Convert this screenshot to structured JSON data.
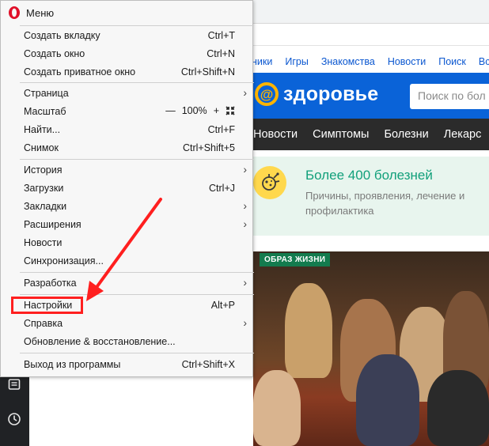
{
  "menu": {
    "title": "Меню",
    "groups": [
      [
        {
          "label": "Создать вкладку",
          "shortcut": "Ctrl+T"
        },
        {
          "label": "Создать окно",
          "shortcut": "Ctrl+N"
        },
        {
          "label": "Создать приватное окно",
          "shortcut": "Ctrl+Shift+N"
        }
      ],
      [
        {
          "label": "Страница",
          "submenu": true
        },
        {
          "label": "Масштаб",
          "zoom": {
            "minus": "—",
            "value": "100%",
            "plus": "+"
          }
        },
        {
          "label": "Найти...",
          "shortcut": "Ctrl+F"
        },
        {
          "label": "Снимок",
          "shortcut": "Ctrl+Shift+5"
        }
      ],
      [
        {
          "label": "История",
          "submenu": true
        },
        {
          "label": "Загрузки",
          "shortcut": "Ctrl+J"
        },
        {
          "label": "Закладки",
          "submenu": true
        },
        {
          "label": "Расширения",
          "submenu": true
        },
        {
          "label": "Новости"
        },
        {
          "label": "Синхронизация..."
        }
      ],
      [
        {
          "label": "Разработка",
          "submenu": true
        }
      ],
      [
        {
          "label": "Настройки",
          "shortcut": "Alt+P"
        },
        {
          "label": "Справка",
          "submenu": true
        },
        {
          "label": "Обновление & восстановление..."
        }
      ],
      [
        {
          "label": "Выход из программы",
          "shortcut": "Ctrl+Shift+X"
        }
      ]
    ]
  },
  "site": {
    "nav": [
      "ники",
      "Игры",
      "Знакомства",
      "Новости",
      "Поиск",
      "Вс"
    ],
    "logo_symbol": "@",
    "logo_text": "здоровье",
    "search_placeholder": "Поиск по бол",
    "categories": [
      "Новости",
      "Симптомы",
      "Болезни",
      "Лекарс"
    ],
    "promo_title": "Более 400 болезней",
    "promo_subtitle": "Причины, проявления, лечение и профилактика",
    "photo_badge": "ОБРАЗ ЖИЗНИ"
  },
  "colors": {
    "menu_bg": "#f7f7f7",
    "site_header": "#0a63d8",
    "category_bar": "#2b2b2b",
    "promo_bg": "#e8f5ee",
    "accent_green": "#12a07b",
    "annotation_red": "#ff1f1f"
  },
  "icons": {
    "opera": "opera-logo-icon",
    "side_news": "news-icon",
    "side_history": "clock-icon",
    "submenu": "chevron-right-icon",
    "fullscreen": "fullscreen-icon",
    "promo": "virus-icon"
  }
}
